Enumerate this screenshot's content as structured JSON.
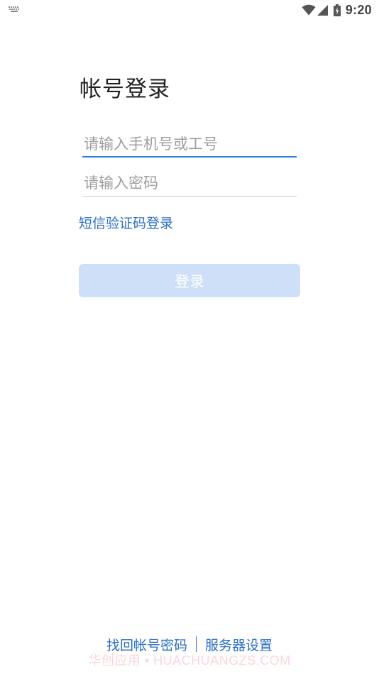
{
  "status_bar": {
    "time": "9:20",
    "icons": [
      "keyboard-icon",
      "wifi-icon",
      "signal-icon",
      "battery-charging-icon"
    ]
  },
  "login": {
    "title": "帐号登录",
    "account_placeholder": "请输入手机号或工号",
    "account_value": "",
    "password_placeholder": "请输入密码",
    "password_value": "",
    "sms_login_link": "短信验证码登录",
    "login_button": "登录"
  },
  "footer": {
    "forgot_password": "找回帐号密码",
    "server_settings": "服务器设置"
  },
  "watermark": "华创应用 • HUACHUANGZS.COM",
  "colors": {
    "accent": "#2f7fd8",
    "link": "#2b6fc2",
    "button_disabled_bg": "#cde0f7",
    "divider": "#cccccc"
  }
}
